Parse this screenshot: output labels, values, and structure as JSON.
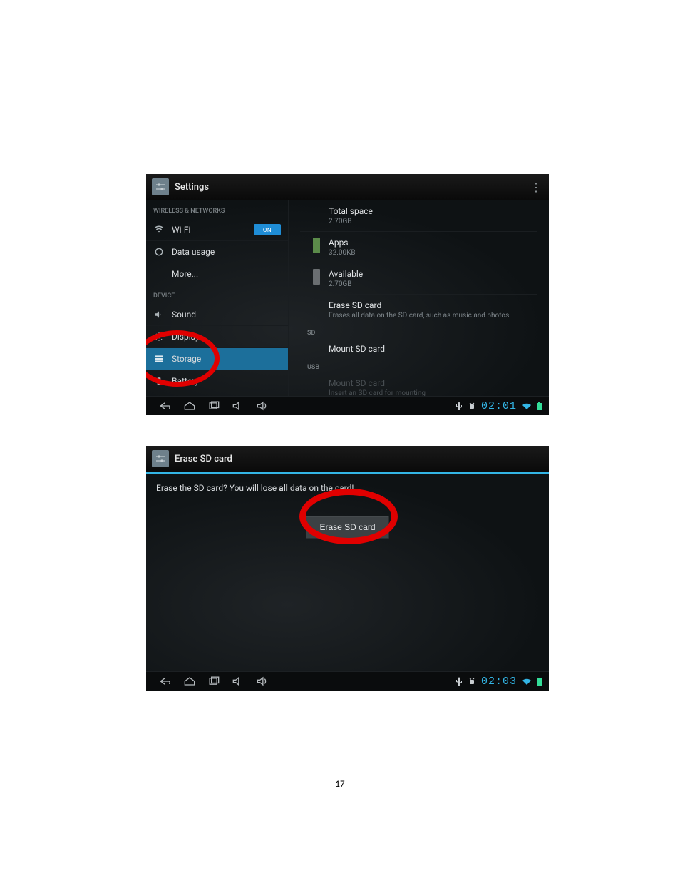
{
  "page_number": "17",
  "screenshot_settings": {
    "header_title": "Settings",
    "categories": {
      "wireless": "WIRELESS & NETWORKS",
      "device": "DEVICE"
    },
    "sidebar": {
      "wifi": "Wi-Fi",
      "wifi_toggle": "ON",
      "data_usage": "Data usage",
      "more": "More...",
      "sound": "Sound",
      "display": "Display",
      "storage": "Storage",
      "battery": "Battery"
    },
    "content": {
      "total_space": {
        "title": "Total space",
        "value": "2.70GB"
      },
      "apps": {
        "title": "Apps",
        "value": "32.00KB"
      },
      "available": {
        "title": "Available",
        "value": "2.70GB"
      },
      "erase": {
        "title": "Erase SD card",
        "sub": "Erases all data on the SD card, such as music and photos"
      },
      "sd_header": "SD",
      "mount": "Mount SD card",
      "usb_header": "USB",
      "mount2": {
        "title": "Mount SD card",
        "sub": "Insert an SD card for mounting"
      }
    },
    "navbar": {
      "clock": "02:01"
    }
  },
  "screenshot_erase": {
    "header_title": "Erase SD card",
    "prompt_prefix": "Erase the SD card? You will lose ",
    "prompt_bold": "all",
    "prompt_suffix": " data on the card!",
    "button": "Erase SD card",
    "navbar": {
      "clock": "02:03"
    }
  }
}
